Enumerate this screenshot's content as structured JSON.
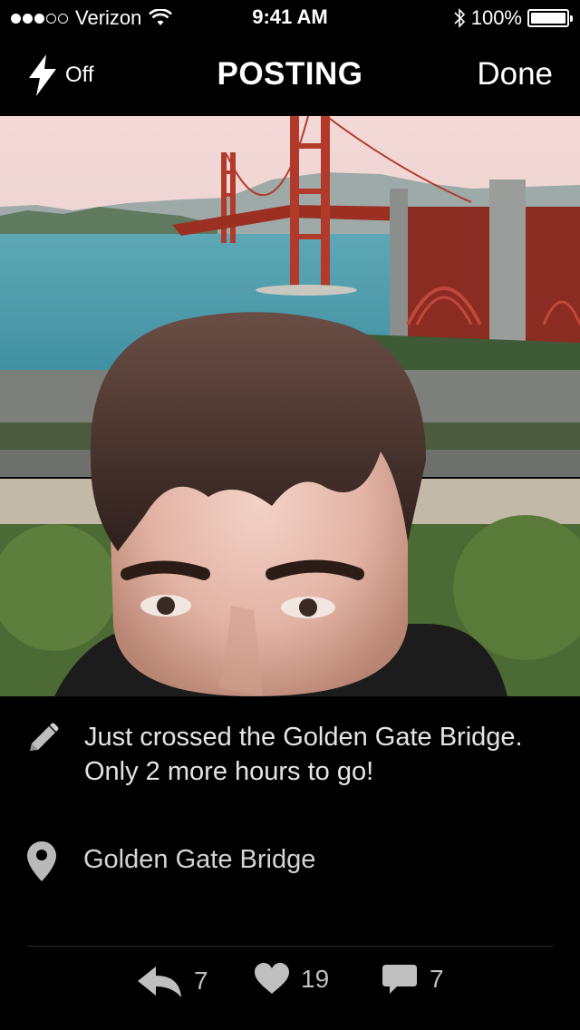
{
  "status_bar": {
    "carrier": "Verizon",
    "time": "9:41 AM",
    "battery": "100%"
  },
  "nav": {
    "flash_label": "Off",
    "title": "POSTING",
    "done_label": "Done"
  },
  "post": {
    "caption": "Just crossed the Golden Gate Bridge. Only 2 more hours to go!",
    "location": "Golden Gate Bridge"
  },
  "actions": {
    "reblog_count": "7",
    "like_count": "19",
    "reply_count": "7"
  },
  "colors": {
    "background": "#000000",
    "bridge": "#b23a2a",
    "water": "#4a97a6",
    "sky": "#efd8d6"
  },
  "icons": [
    "flash-icon",
    "pencil-icon",
    "location-pin-icon",
    "reblog-icon",
    "heart-icon",
    "comment-icon",
    "wifi-icon",
    "bluetooth-icon",
    "battery-icon"
  ]
}
